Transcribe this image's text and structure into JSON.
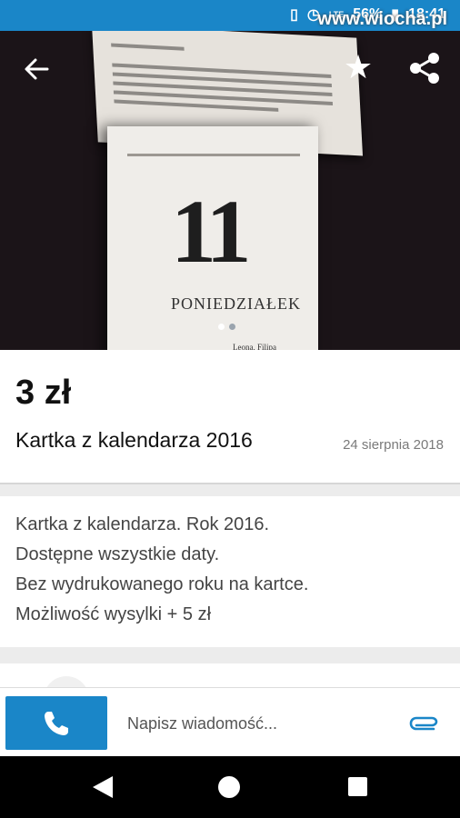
{
  "status_bar": {
    "network": "LTE",
    "battery": "56%",
    "time": "18:41",
    "watermark": "www.wiocha.pl",
    "icons": [
      "vibrate-icon",
      "alarm-icon",
      "signal-icon",
      "battery-icon"
    ]
  },
  "photo": {
    "day_number": "11",
    "day_name": "PONIEDZIAŁEK",
    "saint": "Leona, Filipa",
    "image_count": 2,
    "active_image": 1
  },
  "toolbar": {
    "back_icon": "arrow-left-icon",
    "favorite_icon": "star-icon",
    "share_icon": "share-icon"
  },
  "listing": {
    "price": "3 zł",
    "title": "Kartka z kalendarza 2016",
    "date": "24 sierpnia 2018"
  },
  "description": {
    "lines": [
      "Kartka z kalendarza. Rok 2016.",
      "Dostępne wszystkie daty.",
      "Bez wydrukowanego roku na kartce.",
      "Możliwość wysylki + 5 zł"
    ]
  },
  "message_bar": {
    "call_icon": "phone-icon",
    "placeholder": "Napisz wiadomość...",
    "attach_icon": "paperclip-icon"
  },
  "colors": {
    "accent": "#1a86c8"
  }
}
